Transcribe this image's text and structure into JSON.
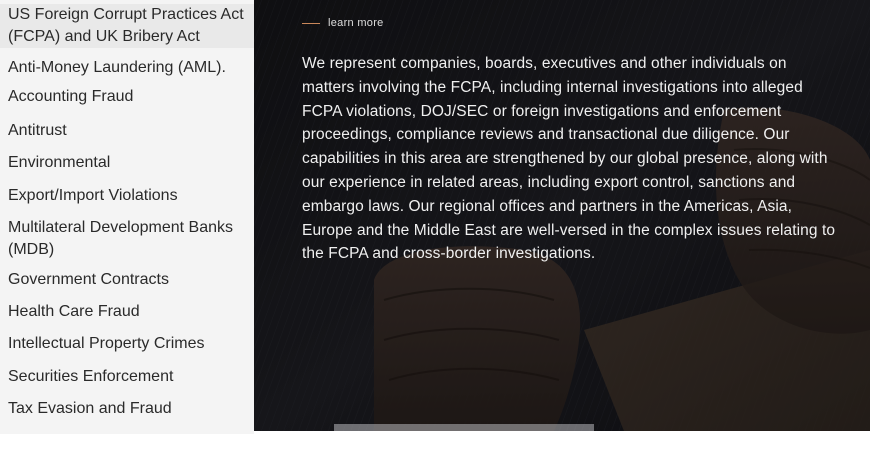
{
  "sidebar": {
    "items": [
      {
        "label": "US Foreign Corrupt Practices Act (FCPA) and UK Bribery Act",
        "active": true
      },
      {
        "label": "Anti-Money Laundering (AML)."
      },
      {
        "label": "Accounting Fraud"
      },
      {
        "label": "Antitrust"
      },
      {
        "label": "Environmental"
      },
      {
        "label": "Export/Import Violations"
      },
      {
        "label": "Multilateral Development Banks (MDB)"
      },
      {
        "label": "Government Contracts"
      },
      {
        "label": "Health Care Fraud"
      },
      {
        "label": "Intellectual Property Crimes"
      },
      {
        "label": "Securities Enforcement"
      },
      {
        "label": "Tax Evasion and Fraud"
      }
    ]
  },
  "hero": {
    "learn_more": "learn more",
    "description": "We represent companies, boards, executives and other individuals on matters involving the FCPA, including internal investigations into alleged FCPA violations, DOJ/SEC or foreign investigations and enforcement proceedings, compliance reviews and transactional due diligence. Our capabilities in this area are strengthened by our global presence, along with our experience in related areas, including export control, sanctions and embargo laws. Our regional offices and partners in the Americas, Asia, Europe and the Middle East are well-versed in the complex issues relating to the FCPA and cross-border investigations."
  },
  "colors": {
    "accent": "#c9875a",
    "sidebar_bg": "#f4f4f4",
    "sidebar_active": "#e9e9e9",
    "hero_text": "#f0f0f0"
  }
}
